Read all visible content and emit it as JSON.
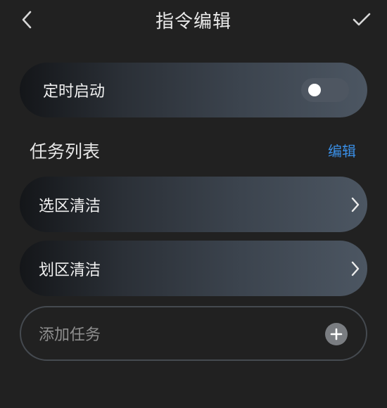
{
  "header": {
    "title": "指令编辑",
    "back_icon": "chevron-left-icon",
    "confirm_icon": "check-icon"
  },
  "timer": {
    "label": "定时启动",
    "enabled": false
  },
  "task_section": {
    "title": "任务列表",
    "edit_label": "编辑"
  },
  "tasks": [
    {
      "label": "选区清洁",
      "icon": "chevron-right-icon"
    },
    {
      "label": "划区清洁",
      "icon": "chevron-right-icon"
    }
  ],
  "add_task": {
    "label": "添加任务",
    "icon": "plus-icon"
  },
  "colors": {
    "background": "#212121",
    "accent": "#3a8fe6",
    "card_gradient_start": "#141619",
    "card_gradient_end": "#4c5662"
  }
}
